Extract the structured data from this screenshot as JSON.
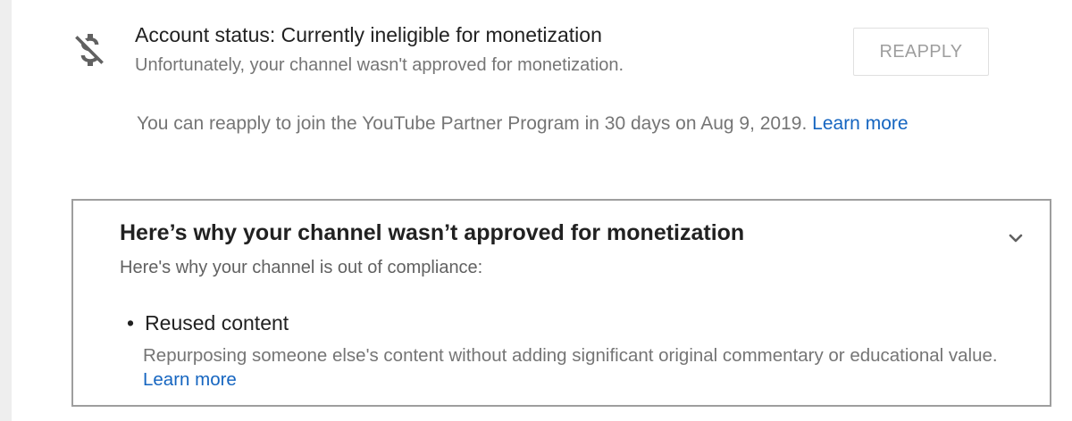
{
  "account_status": {
    "icon": "money-off-icon",
    "title": "Account status: Currently ineligible for monetization",
    "subtitle": "Unfortunately, your channel wasn't approved for monetization.",
    "reapply_button": "REAPPLY",
    "reapply_note": "You can reapply to join the YouTube Partner Program in 30 days on Aug 9, 2019.",
    "learn_more": "Learn more"
  },
  "why_card": {
    "title": "Here’s why your channel wasn’t approved for monetization",
    "subtitle": "Here's why your channel is out of compliance:",
    "expand_icon": "chevron-down-icon",
    "reasons": [
      {
        "bullet": "•",
        "title": "Reused content",
        "description": "Repurposing someone else's content without adding significant original commentary or educational value.",
        "learn_more": "Learn more"
      }
    ]
  },
  "colors": {
    "link": "#1565c0",
    "secondary_text": "#757575",
    "border": "#9e9e9e"
  }
}
